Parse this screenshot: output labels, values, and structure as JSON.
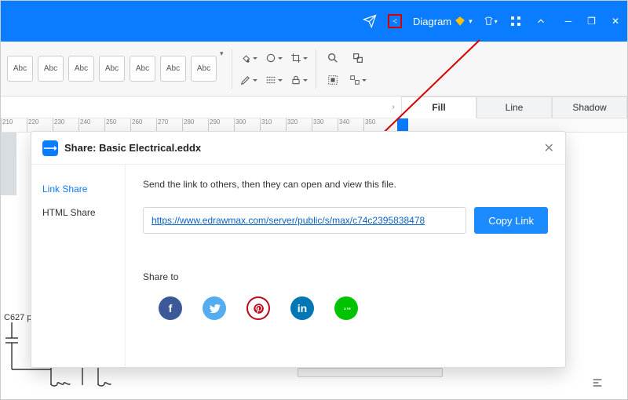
{
  "titlebar": {
    "diagram_label": "Diagram"
  },
  "toolbar": {
    "abc_items": [
      "Abc",
      "Abc",
      "Abc",
      "Abc",
      "Abc",
      "Abc",
      "Abc"
    ]
  },
  "tabs": {
    "fill": "Fill",
    "line": "Line",
    "shadow": "Shadow"
  },
  "ruler": {
    "ticks": [
      "210",
      "220",
      "230",
      "240",
      "250",
      "260",
      "270",
      "280",
      "290",
      "300",
      "310",
      "320",
      "330",
      "340",
      "350"
    ]
  },
  "canvas": {
    "component_label": "C627 p"
  },
  "dialog": {
    "title": "Share: Basic Electrical.eddx",
    "side": {
      "link": "Link Share",
      "html": "HTML Share"
    },
    "desc": "Send the link to others, then they can open and view this file.",
    "url": "https://www.edrawmax.com/server/public/s/max/c74c2395838478",
    "copy": "Copy Link",
    "share_to": "Share to"
  }
}
